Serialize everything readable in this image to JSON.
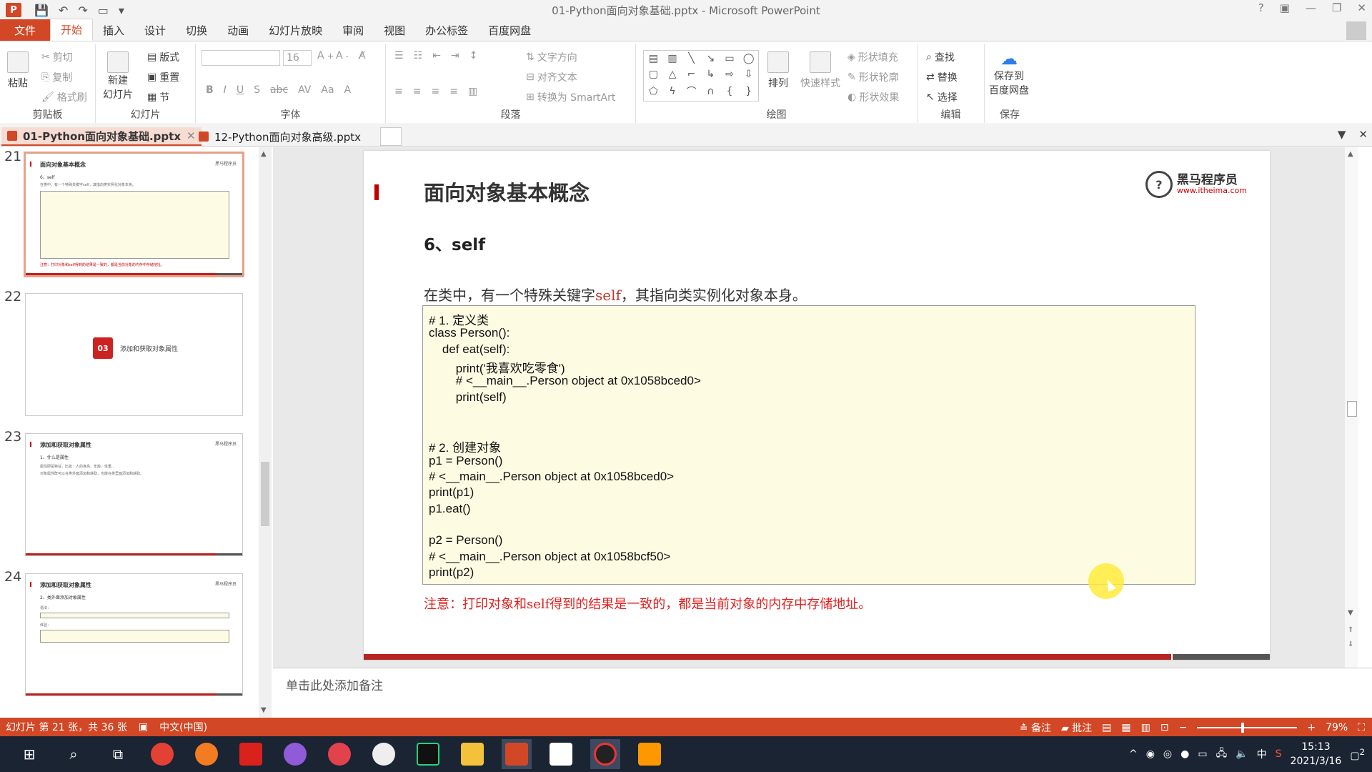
{
  "window": {
    "title": "01-Python面向对象基础.pptx - Microsoft PowerPoint",
    "app_letter": "P"
  },
  "menu": {
    "file": "文件",
    "tabs": [
      "开始",
      "插入",
      "设计",
      "切换",
      "动画",
      "幻灯片放映",
      "审阅",
      "视图",
      "办公标签",
      "百度网盘"
    ],
    "active_tab": "开始"
  },
  "ribbon": {
    "clipboard": {
      "label": "剪贴板",
      "paste": "粘贴",
      "cut": "剪切",
      "copy": "复制",
      "format_painter": "格式刷"
    },
    "slides": {
      "label": "幻灯片",
      "new_slide_line1": "新建",
      "new_slide_line2": "幻灯片",
      "layout": "版式",
      "reset": "重置",
      "section": "节"
    },
    "font": {
      "label": "字体",
      "size": "16"
    },
    "paragraph": {
      "label": "段落",
      "text_direction": "文字方向",
      "align_text": "对齐文本",
      "smartart": "转换为 SmartArt"
    },
    "drawing": {
      "label": "绘图",
      "arrange": "排列",
      "quick_styles": "快速样式",
      "shape_fill": "形状填充",
      "shape_outline": "形状轮廓",
      "shape_effects": "形状效果"
    },
    "editing": {
      "label": "编辑",
      "find": "查找",
      "replace": "替换",
      "select": "选择"
    },
    "save": {
      "label": "保存",
      "btn_line1": "保存到",
      "btn_line2": "百度网盘"
    }
  },
  "doc_tabs": [
    {
      "label": "01-Python面向对象基础.pptx",
      "active": true
    },
    {
      "label": "12-Python面向对象高级.pptx",
      "active": false
    }
  ],
  "thumbnails": [
    {
      "num": "21",
      "title": "面向对象基本概念",
      "sub": "6、self",
      "lines": [
        "在类中，有一个特殊关键字self，其指向类实例化对象本身。"
      ],
      "note": "注意：打印对象和self得到的结果是一致的，都是当前对象的内存中存储地址。"
    },
    {
      "num": "22",
      "badge": "03",
      "badge_text": "添加和获取对象属性"
    },
    {
      "num": "23",
      "title": "添加和获取对象属性",
      "sub": "1、什么是属性",
      "lines": [
        "属性即是特征，比如：人的身高、年龄、体重...",
        "对象属性既可以在类外面添加和获取，也能在类里面添加和获取。"
      ]
    },
    {
      "num": "24",
      "title": "添加和获取对象属性",
      "sub": "2、类外面添加对象属性",
      "lines": [
        "语法：",
        "体验："
      ]
    }
  ],
  "slide": {
    "title": "面向对象基本概念",
    "logo_name": "黑马程序员",
    "logo_url": "www.itheima.com",
    "logo_mark": "?",
    "subtitle": "6、self",
    "intro_pre": "在类中，有一个特殊关键字",
    "intro_kw": "self",
    "intro_post": "，其指向类实例化对象本身。",
    "code": [
      "# 1. 定义类",
      "class Person():",
      "    def eat(self):",
      "        print('我喜欢吃零食')",
      "        # <__main__.Person object at 0x1058bced0>",
      "        print(self)",
      "",
      "",
      "# 2. 创建对象",
      "p1 = Person()",
      "# <__main__.Person object at 0x1058bced0>",
      "print(p1)",
      "p1.eat()",
      "",
      "p2 = Person()",
      "# <__main__.Person object at 0x1058bcf50>",
      "print(p2)"
    ],
    "note": "注意：打印对象和self得到的结果是一致的，都是当前对象的内存中存储地址。"
  },
  "notes_placeholder": "单击此处添加备注",
  "status": {
    "slide_info": "幻灯片 第 21 张，共 36 张",
    "language": "中文(中国)",
    "notes": "备注",
    "comments": "批注",
    "zoom": "79%"
  },
  "taskbar": {
    "time": "15:13",
    "date": "2021/3/16",
    "ime": "中",
    "notif_count": "2"
  },
  "colors": {
    "accent": "#d24726",
    "title_bar_red": "#c00000",
    "code_bg": "#fefbe3",
    "note_red": "#e02020"
  }
}
